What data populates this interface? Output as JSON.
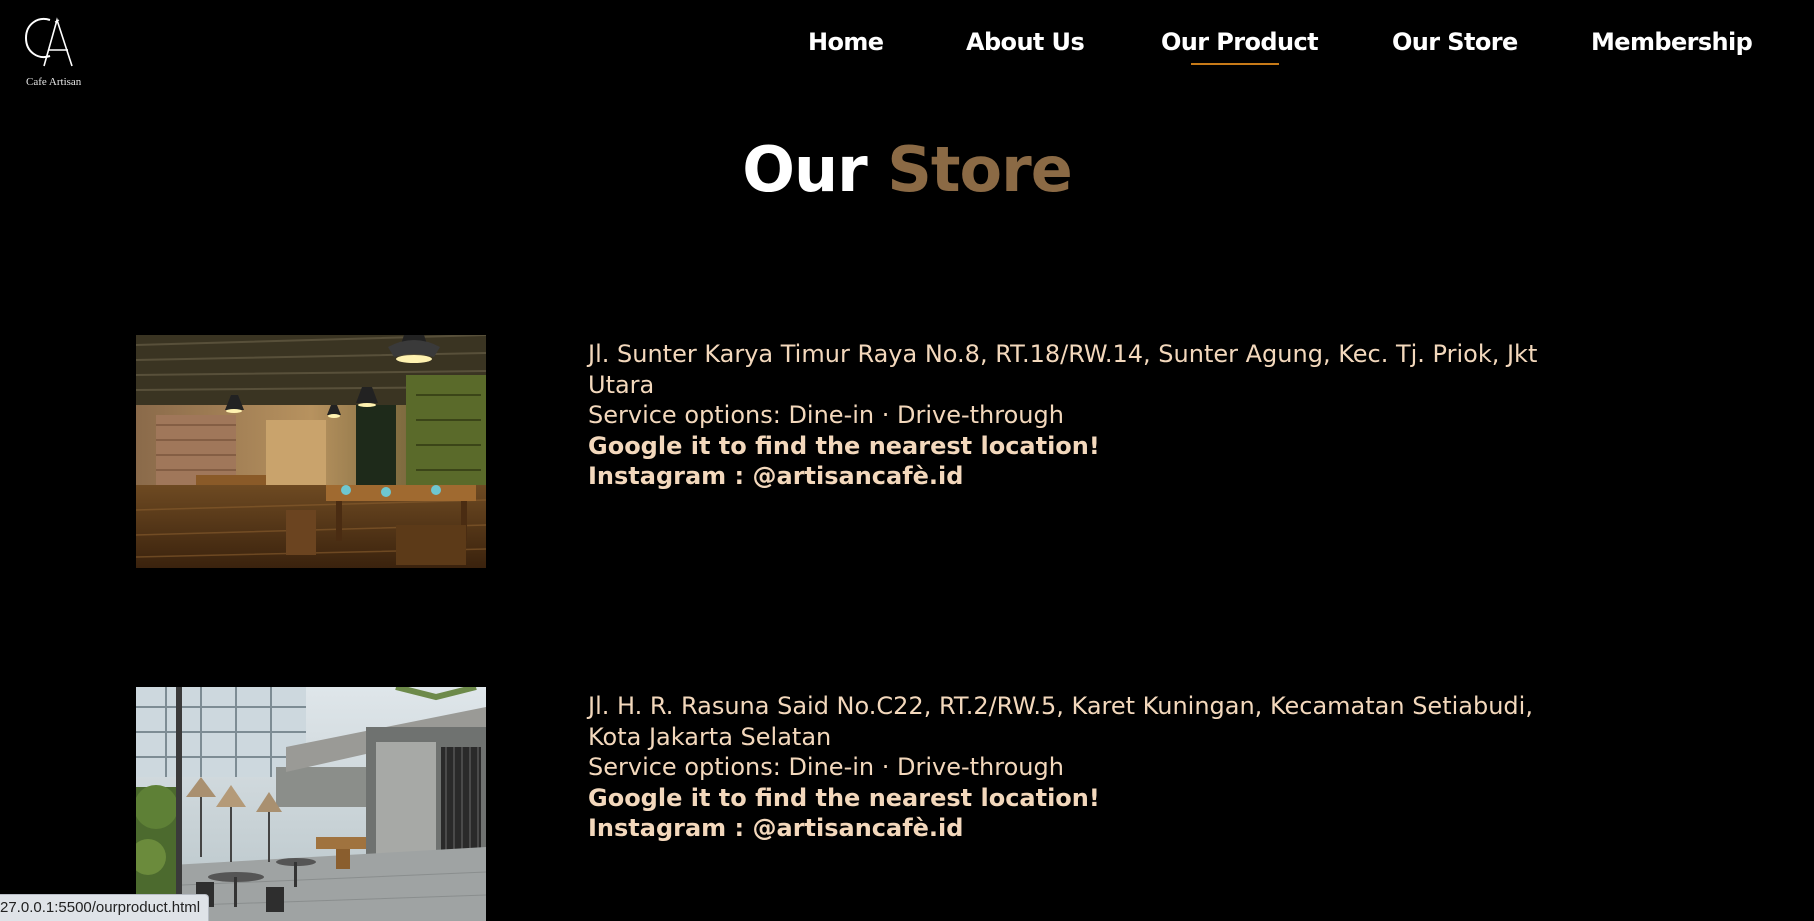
{
  "logo": {
    "monogram": "CA",
    "text": "Cafe Artisan"
  },
  "nav": {
    "items": [
      {
        "label": "Home"
      },
      {
        "label": "About Us"
      },
      {
        "label": "Our Product",
        "active": true
      },
      {
        "label": "Our Store"
      },
      {
        "label": "Membership"
      }
    ],
    "underline_color": "#c77a18"
  },
  "page_title": {
    "word1": "Our",
    "word2": "Store",
    "accent_color": "#8b6a45"
  },
  "stores": [
    {
      "address": "Jl. Sunter Karya Timur Raya No.8, RT.18/RW.14, Sunter Agung, Kec. Tj. Priok, Jkt Utara",
      "service": "Service options: Dine-in · Drive-through",
      "cta": "Google it to find the nearest location!",
      "instagram": "Instagram : @artisancafè.id",
      "photo": "restaurant-interior-photo"
    },
    {
      "address": "Jl. H. R. Rasuna Said No.C22, RT.2/RW.5, Karet Kuningan, Kecamatan Setiabudi, Kota Jakarta Selatan",
      "service": "Service options: Dine-in · Drive-through",
      "cta": "Google it to find the nearest location!",
      "instagram": "Instagram : @artisancafè.id",
      "photo": "outdoor-terrace-photo"
    }
  ],
  "status_bar": {
    "url": "27.0.0.1:5500/ourproduct.html"
  },
  "colors": {
    "background": "#000000",
    "text_body": "#f3d8bc",
    "nav_text": "#ffffff"
  }
}
